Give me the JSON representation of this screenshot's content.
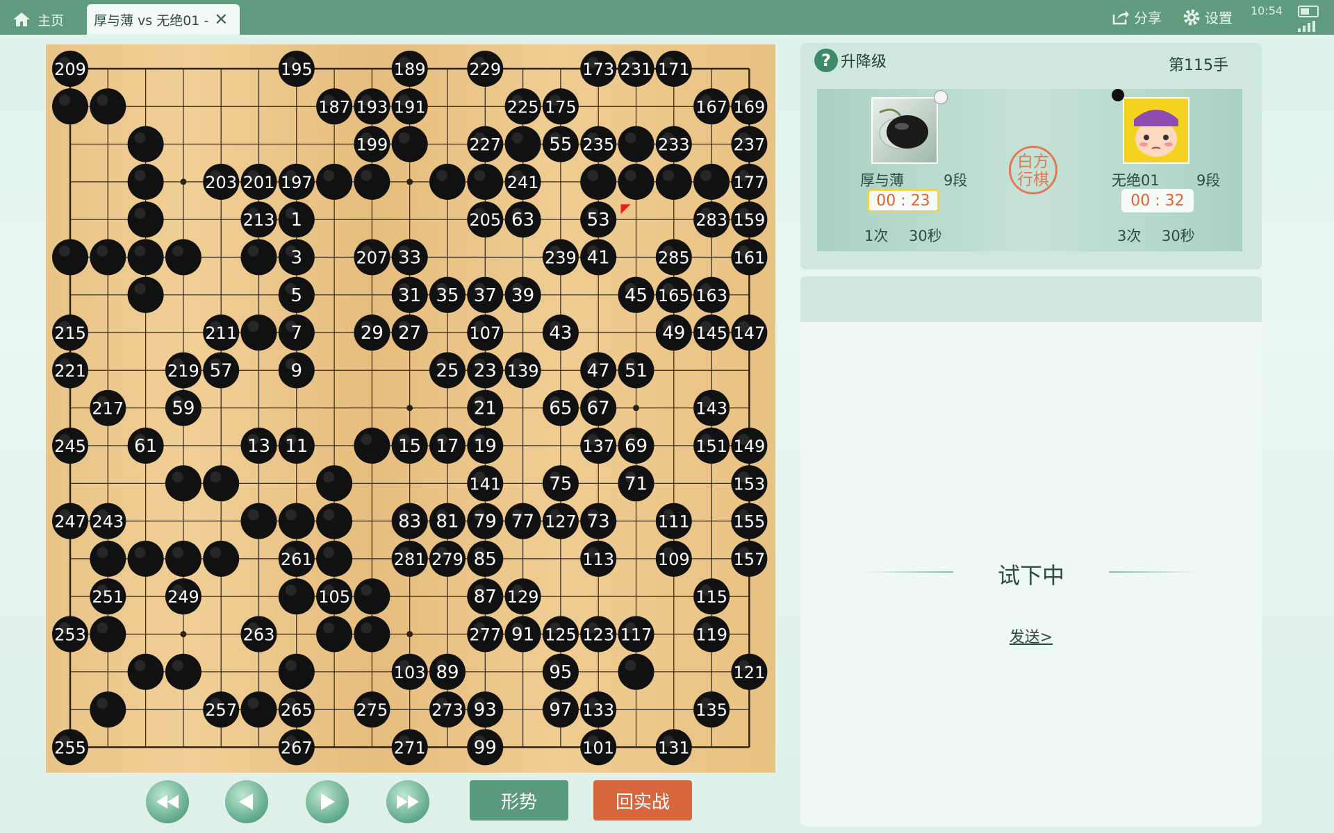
{
  "topbar": {
    "home_tab": "主页",
    "game_tab": "厚与薄 vs 无绝01 -",
    "close_glyph": "✕",
    "share": "分享",
    "settings": "设置",
    "clock": "10:54"
  },
  "panel": {
    "rank_label": "升降级",
    "help_glyph": "?",
    "move_counter": "第115手",
    "seal_text": "白方行棋",
    "left_player": {
      "name": "厚与薄",
      "rank": "9段",
      "timer": "00 : 23",
      "byoyomi_count": "1次",
      "byoyomi_time": "30秒",
      "color": "white"
    },
    "right_player": {
      "name": "无绝01",
      "rank": "9段",
      "timer": "00 : 32",
      "byoyomi_count": "3次",
      "byoyomi_time": "30秒",
      "color": "black"
    }
  },
  "chat": {
    "trying_label": "试下中",
    "send_label": "发送>"
  },
  "controls": {
    "situation": "形势",
    "back_to_game": "回实战"
  },
  "board": {
    "size": 19,
    "last_move": [
      16,
      5
    ],
    "stones": [
      [
        1,
        1,
        "209"
      ],
      [
        7,
        1,
        "195"
      ],
      [
        10,
        1,
        "189"
      ],
      [
        12,
        1,
        "229"
      ],
      [
        15,
        1,
        "173"
      ],
      [
        16,
        1,
        "231"
      ],
      [
        17,
        1,
        "171"
      ],
      [
        1,
        2,
        ""
      ],
      [
        2,
        2,
        ""
      ],
      [
        8,
        2,
        "187"
      ],
      [
        9,
        2,
        "193"
      ],
      [
        10,
        2,
        "191"
      ],
      [
        13,
        2,
        "225"
      ],
      [
        14,
        2,
        "175"
      ],
      [
        18,
        2,
        "167"
      ],
      [
        19,
        2,
        "169"
      ],
      [
        3,
        3,
        ""
      ],
      [
        9,
        3,
        "199"
      ],
      [
        10,
        3,
        ""
      ],
      [
        12,
        3,
        "227"
      ],
      [
        13,
        3,
        ""
      ],
      [
        14,
        3,
        "55"
      ],
      [
        15,
        3,
        "235"
      ],
      [
        16,
        3,
        ""
      ],
      [
        17,
        3,
        "233"
      ],
      [
        19,
        3,
        "237"
      ],
      [
        3,
        4,
        ""
      ],
      [
        5,
        4,
        "203"
      ],
      [
        6,
        4,
        "201"
      ],
      [
        7,
        4,
        "197"
      ],
      [
        8,
        4,
        ""
      ],
      [
        9,
        4,
        ""
      ],
      [
        11,
        4,
        ""
      ],
      [
        12,
        4,
        ""
      ],
      [
        13,
        4,
        "241"
      ],
      [
        15,
        4,
        ""
      ],
      [
        16,
        4,
        ""
      ],
      [
        17,
        4,
        ""
      ],
      [
        18,
        4,
        ""
      ],
      [
        19,
        4,
        "177"
      ],
      [
        3,
        5,
        ""
      ],
      [
        6,
        5,
        "213"
      ],
      [
        7,
        5,
        "1"
      ],
      [
        12,
        5,
        "205"
      ],
      [
        13,
        5,
        "63"
      ],
      [
        15,
        5,
        "53"
      ],
      [
        18,
        5,
        "283"
      ],
      [
        19,
        5,
        "159"
      ],
      [
        1,
        6,
        ""
      ],
      [
        2,
        6,
        ""
      ],
      [
        3,
        6,
        ""
      ],
      [
        4,
        6,
        ""
      ],
      [
        6,
        6,
        ""
      ],
      [
        7,
        6,
        "3"
      ],
      [
        9,
        6,
        "207"
      ],
      [
        10,
        6,
        "33"
      ],
      [
        14,
        6,
        "239"
      ],
      [
        15,
        6,
        "41"
      ],
      [
        17,
        6,
        "285"
      ],
      [
        19,
        6,
        "161"
      ],
      [
        3,
        7,
        ""
      ],
      [
        7,
        7,
        "5"
      ],
      [
        10,
        7,
        "31"
      ],
      [
        11,
        7,
        "35"
      ],
      [
        12,
        7,
        "37"
      ],
      [
        13,
        7,
        "39"
      ],
      [
        16,
        7,
        "45"
      ],
      [
        17,
        7,
        "165"
      ],
      [
        18,
        7,
        "163"
      ],
      [
        1,
        8,
        "215"
      ],
      [
        5,
        8,
        "211"
      ],
      [
        6,
        8,
        ""
      ],
      [
        7,
        8,
        "7"
      ],
      [
        9,
        8,
        "29"
      ],
      [
        10,
        8,
        "27"
      ],
      [
        12,
        8,
        "107"
      ],
      [
        14,
        8,
        "43"
      ],
      [
        17,
        8,
        "49"
      ],
      [
        18,
        8,
        "145"
      ],
      [
        19,
        8,
        "147"
      ],
      [
        1,
        9,
        "221"
      ],
      [
        4,
        9,
        "219"
      ],
      [
        5,
        9,
        "57"
      ],
      [
        7,
        9,
        "9"
      ],
      [
        11,
        9,
        "25"
      ],
      [
        12,
        9,
        "23"
      ],
      [
        13,
        9,
        "139"
      ],
      [
        15,
        9,
        "47"
      ],
      [
        16,
        9,
        "51"
      ],
      [
        2,
        10,
        "217"
      ],
      [
        4,
        10,
        "59"
      ],
      [
        12,
        10,
        "21"
      ],
      [
        14,
        10,
        "65"
      ],
      [
        15,
        10,
        "67"
      ],
      [
        18,
        10,
        "143"
      ],
      [
        1,
        11,
        "245"
      ],
      [
        3,
        11,
        "61"
      ],
      [
        6,
        11,
        "13"
      ],
      [
        7,
        11,
        "11"
      ],
      [
        9,
        11,
        ""
      ],
      [
        10,
        11,
        "15"
      ],
      [
        11,
        11,
        "17"
      ],
      [
        12,
        11,
        "19"
      ],
      [
        15,
        11,
        "137"
      ],
      [
        16,
        11,
        "69"
      ],
      [
        18,
        11,
        "151"
      ],
      [
        19,
        11,
        "149"
      ],
      [
        4,
        12,
        ""
      ],
      [
        5,
        12,
        ""
      ],
      [
        8,
        12,
        ""
      ],
      [
        12,
        12,
        "141"
      ],
      [
        14,
        12,
        "75"
      ],
      [
        16,
        12,
        "71"
      ],
      [
        19,
        12,
        "153"
      ],
      [
        1,
        13,
        "247"
      ],
      [
        2,
        13,
        "243"
      ],
      [
        6,
        13,
        ""
      ],
      [
        7,
        13,
        ""
      ],
      [
        8,
        13,
        ""
      ],
      [
        10,
        13,
        "83"
      ],
      [
        11,
        13,
        "81"
      ],
      [
        12,
        13,
        "79"
      ],
      [
        13,
        13,
        "77"
      ],
      [
        14,
        13,
        "127"
      ],
      [
        15,
        13,
        "73"
      ],
      [
        17,
        13,
        "111"
      ],
      [
        19,
        13,
        "155"
      ],
      [
        2,
        14,
        ""
      ],
      [
        3,
        14,
        ""
      ],
      [
        4,
        14,
        ""
      ],
      [
        5,
        14,
        ""
      ],
      [
        7,
        14,
        "261"
      ],
      [
        8,
        14,
        ""
      ],
      [
        10,
        14,
        "281"
      ],
      [
        11,
        14,
        "279"
      ],
      [
        12,
        14,
        "85"
      ],
      [
        15,
        14,
        "113"
      ],
      [
        17,
        14,
        "109"
      ],
      [
        19,
        14,
        "157"
      ],
      [
        2,
        15,
        "251"
      ],
      [
        4,
        15,
        "249"
      ],
      [
        7,
        15,
        ""
      ],
      [
        8,
        15,
        "105"
      ],
      [
        9,
        15,
        ""
      ],
      [
        12,
        15,
        "87"
      ],
      [
        13,
        15,
        "129"
      ],
      [
        18,
        15,
        "115"
      ],
      [
        1,
        16,
        "253"
      ],
      [
        2,
        16,
        ""
      ],
      [
        6,
        16,
        "263"
      ],
      [
        8,
        16,
        ""
      ],
      [
        9,
        16,
        ""
      ],
      [
        12,
        16,
        "277"
      ],
      [
        13,
        16,
        "91"
      ],
      [
        14,
        16,
        "125"
      ],
      [
        15,
        16,
        "123"
      ],
      [
        16,
        16,
        "117"
      ],
      [
        18,
        16,
        "119"
      ],
      [
        3,
        17,
        ""
      ],
      [
        4,
        17,
        ""
      ],
      [
        7,
        17,
        ""
      ],
      [
        10,
        17,
        "103"
      ],
      [
        11,
        17,
        "89"
      ],
      [
        14,
        17,
        "95"
      ],
      [
        16,
        17,
        ""
      ],
      [
        19,
        17,
        "121"
      ],
      [
        2,
        18,
        ""
      ],
      [
        5,
        18,
        "257"
      ],
      [
        6,
        18,
        ""
      ],
      [
        7,
        18,
        "265"
      ],
      [
        9,
        18,
        "275"
      ],
      [
        11,
        18,
        "273"
      ],
      [
        12,
        18,
        "93"
      ],
      [
        14,
        18,
        "97"
      ],
      [
        15,
        18,
        "133"
      ],
      [
        18,
        18,
        "135"
      ],
      [
        1,
        19,
        "255"
      ],
      [
        7,
        19,
        "267"
      ],
      [
        10,
        19,
        "271"
      ],
      [
        12,
        19,
        "99"
      ],
      [
        15,
        19,
        "101"
      ],
      [
        17,
        19,
        "131"
      ]
    ]
  },
  "colors": {
    "topbar": "#5f9c7e",
    "board": "#ecc78b",
    "stone": "#111111",
    "accent_green": "#5b9a7d",
    "accent_orange": "#d9673e",
    "timer_text": "#e0622e"
  }
}
